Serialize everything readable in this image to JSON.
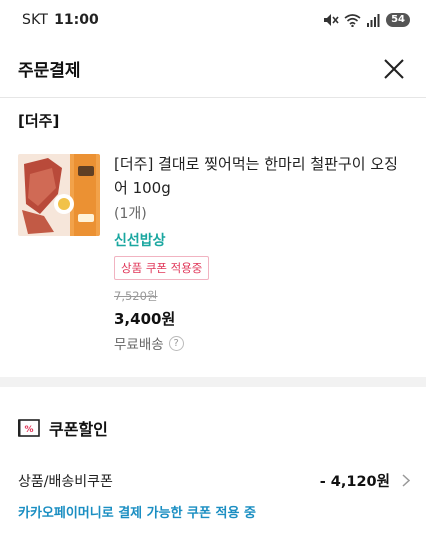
{
  "status_bar": {
    "carrier": "SKT",
    "time": "11:00",
    "battery": "54",
    "icons": [
      "mute-icon",
      "wifi-icon",
      "signal-icon",
      "battery-icon"
    ]
  },
  "header": {
    "title": "주문결제",
    "close_icon": "close-icon"
  },
  "order": {
    "seller": "[더주]",
    "product": {
      "name": "[더주] 결대로 찢어먹는 한마리 철판구이 오징어 100g",
      "quantity": "(1개)",
      "brand": "신선밥상",
      "coupon_badge": "상품 쿠폰 적용중",
      "original_price": "7,520원",
      "price": "3,400원",
      "shipping": "무료배송",
      "help_icon": "question-icon"
    }
  },
  "coupon_section": {
    "title": "쿠폰할인",
    "icon": "coupon-percent-icon",
    "row_label": "상품/배송비쿠폰",
    "row_amount": "- 4,120원",
    "note": "카카오페이머니로 결제 가능한 쿠폰 적용 중"
  },
  "colors": {
    "brand_teal": "#1aa7a0",
    "coupon_pink": "#e0385a",
    "note_blue": "#1a8ec2",
    "divider_gray": "#f2f2f2"
  }
}
